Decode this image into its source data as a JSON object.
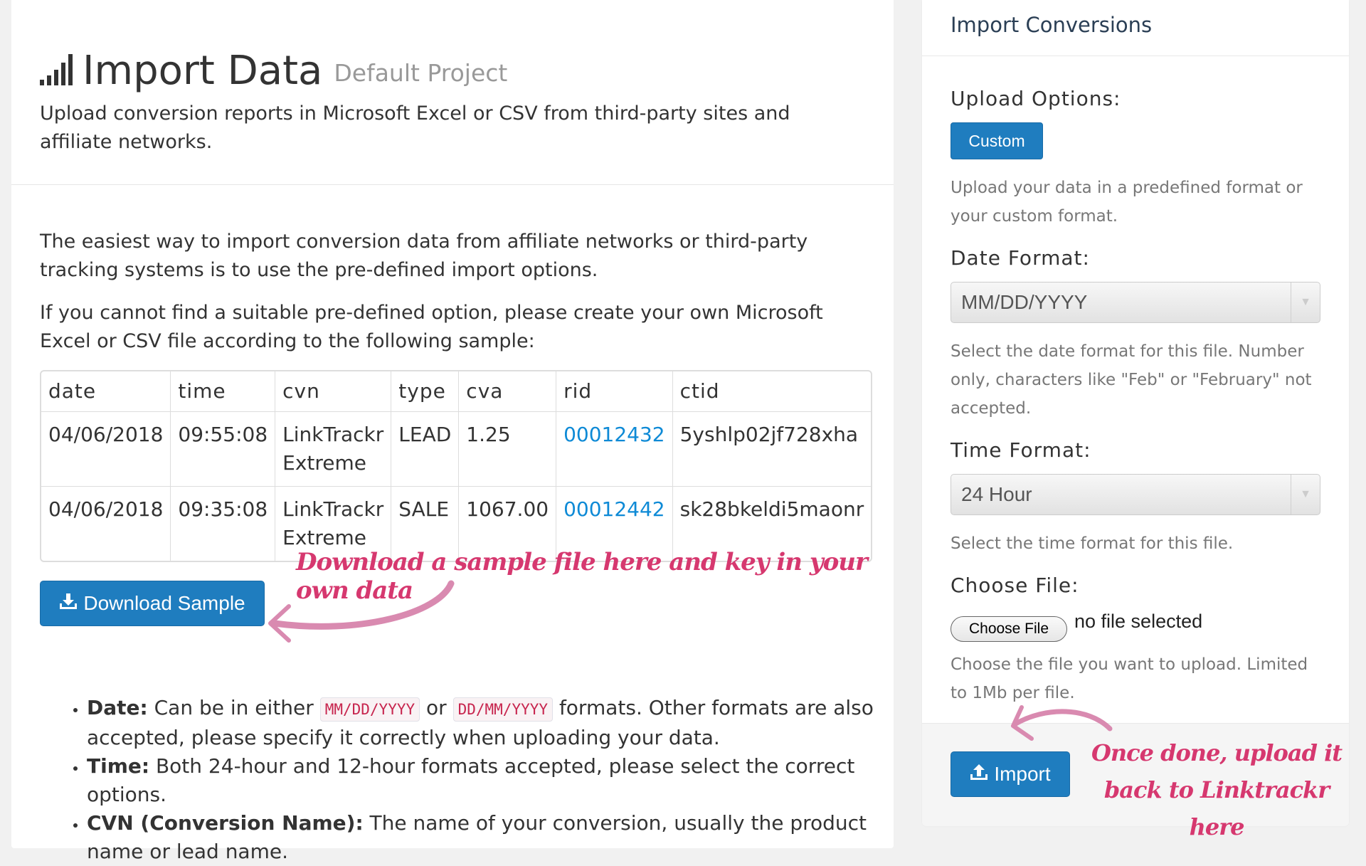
{
  "header": {
    "title": "Import Data",
    "project": "Default Project",
    "intro": "Upload conversion reports in Microsoft Excel or CSV from third-party sites and affiliate networks."
  },
  "body": {
    "para1": "The easiest way to import conversion data from affiliate networks or third-party tracking systems is to use the pre-defined import options.",
    "para2": "If you cannot find a suitable pre-defined option, please create your own Microsoft Excel or CSV file according to the following sample:"
  },
  "sample_table": {
    "columns": [
      "date",
      "time",
      "cvn",
      "type",
      "cva",
      "rid",
      "ctid"
    ],
    "rows": [
      [
        "04/06/2018",
        "09:55:08",
        "LinkTrackr Extreme",
        "LEAD",
        "1.25",
        "00012432",
        "5yshlp02jf728xha"
      ],
      [
        "04/06/2018",
        "09:35:08",
        "LinkTrackr Extreme",
        "SALE",
        "1067.00",
        "00012442",
        "sk28bkeldi5maonr"
      ]
    ]
  },
  "download_button": "Download Sample",
  "annotations": {
    "download": "Download a sample file here and key in your own data",
    "upload": "Once done, upload it back to Linktrackr here"
  },
  "notes": {
    "date_term": "Date:",
    "date_text_1": "Can be in either",
    "date_fmt_1": "MM/DD/YYYY",
    "date_or": "or",
    "date_fmt_2": "DD/MM/YYYY",
    "date_text_2": "formats. Other formats are also accepted, please specify it correctly when uploading your data.",
    "time_term": "Time:",
    "time_text": "Both 24-hour and 12-hour formats accepted, please select the correct options.",
    "cvn_term": "CVN (Conversion Name):",
    "cvn_text": "The name of your conversion, usually the product name or lead name."
  },
  "import_panel": {
    "title": "Import Conversions",
    "upload_options_label": "Upload Options:",
    "custom_button": "Custom",
    "upload_options_help": "Upload your data in a predefined format or your custom format.",
    "date_format_label": "Date Format:",
    "date_format_value": "MM/DD/YYYY",
    "date_format_help": "Select the date format for this file. Number only, characters like \"Feb\" or \"February\" not accepted.",
    "time_format_label": "Time Format:",
    "time_format_value": "24 Hour",
    "time_format_help": "Select the time format for this file.",
    "choose_file_label": "Choose File:",
    "choose_file_button": "Choose File",
    "no_file": "no file selected",
    "choose_file_help": "Choose the file you want to upload. Limited to 1Mb per file.",
    "import_button": "Import"
  },
  "colors": {
    "primary": "#1f7dbf",
    "annotation": "#d6386f",
    "link": "#0e8ad6"
  }
}
